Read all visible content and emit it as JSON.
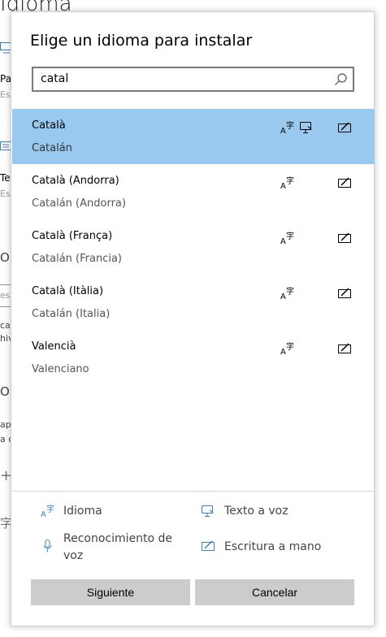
{
  "background": {
    "title": "Idioma",
    "items": [
      "Par",
      "Esp",
      "Tec",
      "Esp",
      "O",
      "esp",
      "ca",
      "hiv",
      "O",
      "ap",
      "a c",
      "+",
      "字"
    ]
  },
  "dialog": {
    "title": "Elige un idioma para instalar",
    "search": {
      "value": "catal",
      "icon": "search-icon"
    },
    "languages": [
      {
        "name": "Català",
        "local": "Catalán",
        "selected": true,
        "features": [
          "language-pack",
          "text-to-speech",
          "handwriting"
        ]
      },
      {
        "name": "Català (Andorra)",
        "local": "Catalán (Andorra)",
        "selected": false,
        "features": [
          "language-pack",
          "handwriting"
        ]
      },
      {
        "name": "Català (França)",
        "local": "Catalán (Francia)",
        "selected": false,
        "features": [
          "language-pack",
          "handwriting"
        ]
      },
      {
        "name": "Català (Itàlia)",
        "local": "Catalán (Italia)",
        "selected": false,
        "features": [
          "language-pack",
          "handwriting"
        ]
      },
      {
        "name": "Valencià",
        "local": "Valenciano",
        "selected": false,
        "features": [
          "language-pack",
          "handwriting"
        ]
      }
    ],
    "legend": {
      "language": "Idioma",
      "tts": "Texto a voz",
      "speech": "Reconocimiento de voz",
      "handwriting": "Escritura a mano"
    },
    "buttons": {
      "next": "Siguiente",
      "cancel": "Cancelar"
    },
    "colors": {
      "selected_row": "#99c9ef",
      "button": "#cccccc",
      "icon_accent": "#3a7fc6"
    }
  }
}
